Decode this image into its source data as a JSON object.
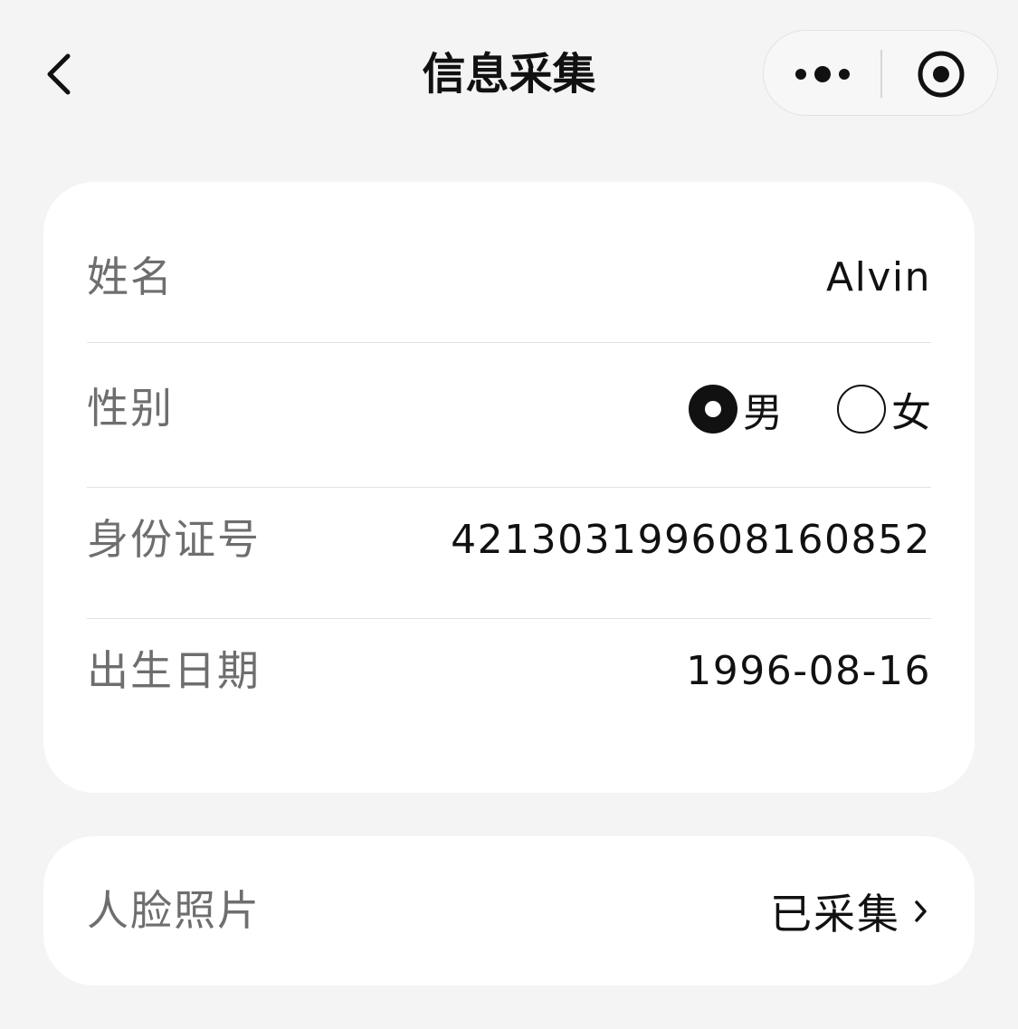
{
  "nav": {
    "title": "信息采集",
    "back_icon": "chevron-left-icon",
    "more_icon": "more-dots-icon",
    "close_icon": "target-circle-icon"
  },
  "form": {
    "name": {
      "label": "姓名",
      "value": "Alvin"
    },
    "gender": {
      "label": "性别",
      "options": [
        {
          "label": "男",
          "selected": true
        },
        {
          "label": "女",
          "selected": false
        }
      ]
    },
    "id_number": {
      "label": "身份证号",
      "value": "421303199608160852"
    },
    "birth_date": {
      "label": "出生日期",
      "value": "1996-08-16"
    }
  },
  "face_photo": {
    "label": "人脸照片",
    "status": "已采集",
    "icon": "chevron-right-icon"
  }
}
